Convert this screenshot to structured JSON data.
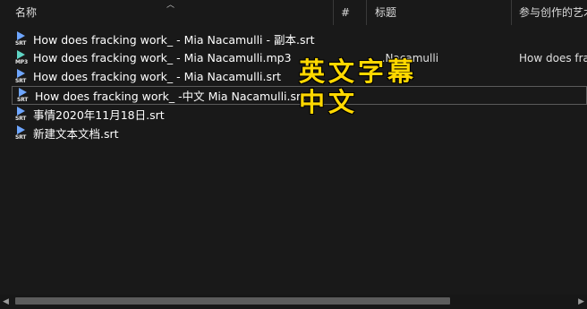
{
  "columns": {
    "name": "名称",
    "number": "#",
    "title": "标题",
    "contributing_artists": "参与创作的艺术家"
  },
  "files": [
    {
      "name": "How does fracking work_ - Mia Nacamulli - 副本.srt",
      "ext": "SRT",
      "title": "",
      "artist": "",
      "selected": false
    },
    {
      "name": "How does fracking work_ - Mia Nacamulli.mp3",
      "ext": "MP3",
      "title": "...Nacamulli",
      "artist": "How does fra",
      "selected": false
    },
    {
      "name": "How does fracking work_ - Mia Nacamulli.srt",
      "ext": "SRT",
      "title": "",
      "artist": "",
      "selected": false
    },
    {
      "name": "How does fracking work_ -中文 Mia Nacamulli.srt",
      "ext": "SRT",
      "title": "",
      "artist": "",
      "selected": true
    },
    {
      "name": "事情2020年11月18日.srt",
      "ext": "SRT",
      "title": "",
      "artist": "",
      "selected": false
    },
    {
      "name": "新建文本文档.srt",
      "ext": "SRT",
      "title": "",
      "artist": "",
      "selected": false
    }
  ],
  "annotations": {
    "english_subtitles": "英文字幕",
    "chinese": "中文"
  },
  "colors": {
    "background": "#191919",
    "annotation": "#ffd800",
    "srt_icon": "#6ea6ff",
    "mp3_icon": "#5fd4c4"
  }
}
